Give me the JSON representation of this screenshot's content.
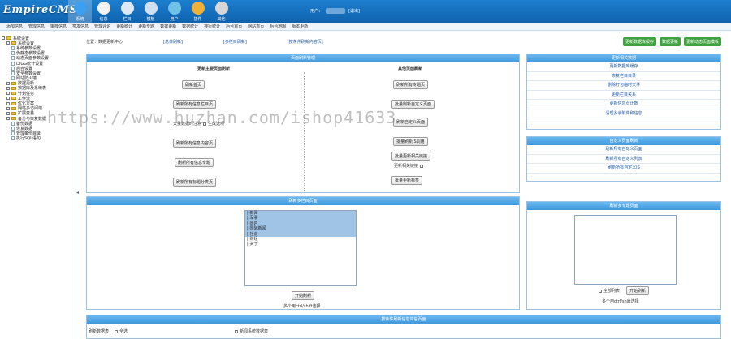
{
  "header": {
    "logo": "EmpireCMS",
    "nav": [
      {
        "label": "系统",
        "icon": "globe-icon",
        "color": "#3aa0ef",
        "active": true
      },
      {
        "label": "信息",
        "icon": "document-icon",
        "color": "#f2f2f2"
      },
      {
        "label": "栏目",
        "icon": "folder-icon",
        "color": "#dfe9f5"
      },
      {
        "label": "模板",
        "icon": "template-icon",
        "color": "#cfe0f2"
      },
      {
        "label": "用户",
        "icon": "user-icon",
        "color": "#6fc1e8"
      },
      {
        "label": "插件",
        "icon": "plugin-icon",
        "color": "#f0b13a"
      },
      {
        "label": "其他",
        "icon": "gear-icon",
        "color": "#d6d6d6"
      }
    ],
    "user_label": "用户：",
    "logout": "[退出]"
  },
  "subnav": [
    "添加信息",
    "管理信息",
    "审核信息",
    "签发信息",
    "管理评论",
    "更新统计",
    "更新专题",
    "数据更新",
    "数据统计",
    "排行统计",
    "后台首页",
    "网站首页",
    "后台地图",
    "版本更新"
  ],
  "tree": [
    {
      "label": "系统设置",
      "kind": "root",
      "indent": 0
    },
    {
      "label": "系统设置",
      "kind": "folder",
      "indent": 1
    },
    {
      "label": "系统参数设置",
      "kind": "doc",
      "indent": 2
    },
    {
      "label": "伪静态参数设置",
      "kind": "doc",
      "indent": 2
    },
    {
      "label": "动态页面参数设置",
      "kind": "doc",
      "indent": 2
    },
    {
      "label": "DIGG统计设置",
      "kind": "doc",
      "indent": 2
    },
    {
      "label": "后台设置",
      "kind": "doc",
      "indent": 2
    },
    {
      "label": "安全参数设置",
      "kind": "doc",
      "indent": 2
    },
    {
      "label": "网站防火墙",
      "kind": "doc",
      "indent": 2
    },
    {
      "label": "数据更新",
      "kind": "folder",
      "indent": 1
    },
    {
      "label": "数据库及系统表",
      "kind": "folder",
      "indent": 1
    },
    {
      "label": "计划任务",
      "kind": "folder",
      "indent": 1
    },
    {
      "label": "工作流",
      "kind": "folder",
      "indent": 1
    },
    {
      "label": "优化方案",
      "kind": "folder",
      "indent": 1
    },
    {
      "label": "网站多访问端",
      "kind": "folder",
      "indent": 1
    },
    {
      "label": "扩展变量",
      "kind": "folder",
      "indent": 1
    },
    {
      "label": "备份与恢复数据",
      "kind": "folder",
      "indent": 1
    },
    {
      "label": "备份数据",
      "kind": "doc",
      "indent": 2
    },
    {
      "label": "恢复数据",
      "kind": "doc",
      "indent": 2
    },
    {
      "label": "管理备份目录",
      "kind": "doc",
      "indent": 2
    },
    {
      "label": "执行SQL语句",
      "kind": "doc",
      "indent": 2
    }
  ],
  "location": {
    "prefix": "位置：数据更新中心",
    "links": [
      "[总体刷新]",
      "[多栏目刷新]",
      "[按条件刷新内容页]"
    ]
  },
  "top_buttons": [
    "更新数据库缓存",
    "数据更新",
    "更新动态页面模板"
  ],
  "main_panel": {
    "title": "页面刷新管理",
    "left_title": "更新主要页面刷新",
    "right_title": "其他页面刷新",
    "left_buttons": [
      "刷新首页",
      "刷新所有信息栏目页",
      "刷新所有信息内容页",
      "刷新所有信息专题",
      "刷新所有标题分类页"
    ],
    "sub_note": "大量数据时注意",
    "sub_check": "生成选项",
    "right_buttons": [
      "刷新所有专题页",
      "批量刷新自定义页面",
      "刷新自定义页面",
      "批量刷新JS调用",
      "批量更新相关链接",
      "批量更新数量",
      "批量更新标签"
    ],
    "update_top": "更新相关表",
    "right_check": "更新相关链接"
  },
  "stats_panel": {
    "title": "更新相关数据",
    "items": [
      "更新数据库缓存",
      "恢复栏目目录",
      "删除打包临时文件",
      "更新栏目关系",
      "更新信息页计数",
      "清理多余附件和信息"
    ]
  },
  "custom_panel": {
    "title": "自定义页面刷新",
    "items": [
      "刷新所有自定义页面",
      "刷新所有自定义列表",
      "刷新所有自定义JS"
    ]
  },
  "column_panel": {
    "title": "刷新多栏目页面",
    "options": [
      "|-新闻",
      "|-军事",
      "|-国内",
      "|-国际新闻",
      "|-社会",
      "|-财经",
      "|-关于"
    ],
    "selected_count": 5,
    "button": "开始刷新",
    "hint": "多个用ctrl/shift选择"
  },
  "special_panel": {
    "title": "刷新多专题页面",
    "checkbox_label": "全部列表",
    "button": "开始刷新",
    "hint": "多个用ctrl/shift选择"
  },
  "bottom_panel": {
    "title": "按条件刷新信息内容页面",
    "field_label": "刷新数据表：",
    "check_all": "全选",
    "check_default": "新闻系统数据表"
  },
  "watermark": "https://www.huzhan.com/ishop41633"
}
